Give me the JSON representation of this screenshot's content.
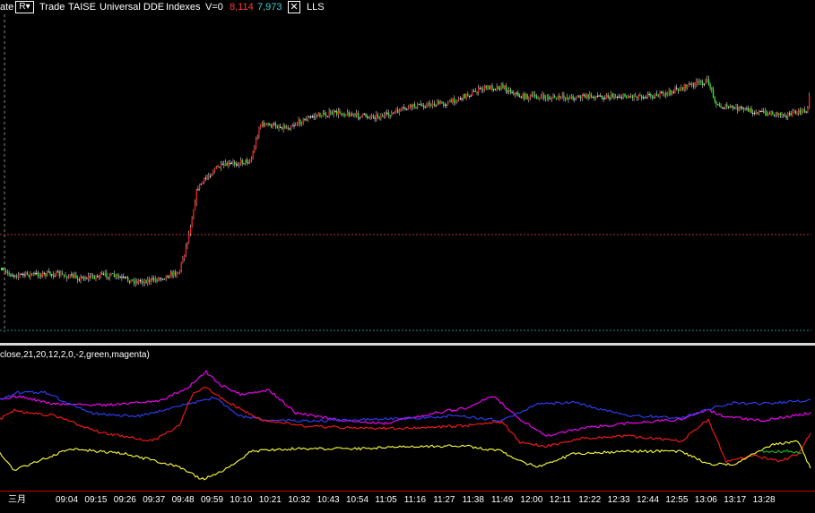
{
  "header": {
    "left_fragment": "ate",
    "mode_button": "R▾",
    "trade_label": "Trade",
    "symbol": "TAISE",
    "source": "Universal DDE",
    "category": "Indexes",
    "volume": "V=0",
    "up_count": "8,114",
    "down_count": "7,973",
    "close_glyph": "✕",
    "tool": "LLS",
    "up_color": "#ff3b3b",
    "down_color": "#3fd0d0"
  },
  "indicator": {
    "label": "close,21,20,12,2,0,-2,green,magenta)"
  },
  "axis": {
    "month": "三月",
    "times": [
      "09:04",
      "09:15",
      "09:26",
      "09:37",
      "09:48",
      "09:59",
      "10:10",
      "10:21",
      "10:32",
      "10:43",
      "10:54",
      "11:05",
      "11:16",
      "11:27",
      "11:38",
      "11:49",
      "12:00",
      "12:11",
      "12:22",
      "12:33",
      "12:44",
      "12:55",
      "13:06",
      "13:17",
      "13:28"
    ]
  },
  "chart_data": [
    {
      "type": "candlestick",
      "colors": {
        "up": "#ff2020",
        "down": "#20ff20",
        "neutral": "#ffffff"
      },
      "reference_line": "dotted red horizontal",
      "price_path": [
        [
          0,
          0.79
        ],
        [
          20,
          0.795
        ],
        [
          60,
          0.792
        ],
        [
          90,
          0.805
        ],
        [
          120,
          0.795
        ],
        [
          150,
          0.815
        ],
        [
          170,
          0.812
        ],
        [
          200,
          0.785
        ],
        [
          210,
          0.68
        ],
        [
          220,
          0.53
        ],
        [
          240,
          0.47
        ],
        [
          260,
          0.455
        ],
        [
          280,
          0.445
        ],
        [
          290,
          0.335
        ],
        [
          320,
          0.345
        ],
        [
          350,
          0.31
        ],
        [
          380,
          0.3
        ],
        [
          400,
          0.31
        ],
        [
          430,
          0.31
        ],
        [
          460,
          0.28
        ],
        [
          500,
          0.27
        ],
        [
          540,
          0.225
        ],
        [
          560,
          0.22
        ],
        [
          580,
          0.25
        ],
        [
          620,
          0.255
        ],
        [
          660,
          0.25
        ],
        [
          700,
          0.25
        ],
        [
          740,
          0.245
        ],
        [
          770,
          0.215
        ],
        [
          790,
          0.205
        ],
        [
          800,
          0.28
        ],
        [
          830,
          0.29
        ],
        [
          850,
          0.3
        ],
        [
          880,
          0.305
        ],
        [
          900,
          0.295
        ],
        [
          905,
          0.21
        ]
      ]
    },
    {
      "type": "line",
      "series": [
        {
          "color": "#ff00ff",
          "values": [
            [
              0,
              0.3
            ],
            [
              20,
              0.27
            ],
            [
              60,
              0.33
            ],
            [
              120,
              0.34
            ],
            [
              180,
              0.3
            ],
            [
              210,
              0.2
            ],
            [
              230,
              0.08
            ],
            [
              245,
              0.18
            ],
            [
              270,
              0.26
            ],
            [
              300,
              0.22
            ],
            [
              330,
              0.4
            ],
            [
              380,
              0.46
            ],
            [
              430,
              0.48
            ],
            [
              470,
              0.42
            ],
            [
              520,
              0.36
            ],
            [
              550,
              0.27
            ],
            [
              580,
              0.45
            ],
            [
              610,
              0.58
            ],
            [
              650,
              0.52
            ],
            [
              700,
              0.48
            ],
            [
              760,
              0.45
            ],
            [
              790,
              0.38
            ],
            [
              810,
              0.43
            ],
            [
              850,
              0.46
            ],
            [
              905,
              0.4
            ]
          ]
        },
        {
          "color": "#3040ff",
          "values": [
            [
              0,
              0.3
            ],
            [
              20,
              0.24
            ],
            [
              50,
              0.24
            ],
            [
              100,
              0.4
            ],
            [
              150,
              0.43
            ],
            [
              210,
              0.33
            ],
            [
              240,
              0.28
            ],
            [
              265,
              0.42
            ],
            [
              300,
              0.46
            ],
            [
              360,
              0.46
            ],
            [
              420,
              0.45
            ],
            [
              470,
              0.44
            ],
            [
              510,
              0.42
            ],
            [
              560,
              0.46
            ],
            [
              600,
              0.33
            ],
            [
              640,
              0.32
            ],
            [
              700,
              0.42
            ],
            [
              760,
              0.44
            ],
            [
              790,
              0.37
            ],
            [
              820,
              0.32
            ],
            [
              850,
              0.33
            ],
            [
              905,
              0.3
            ]
          ]
        },
        {
          "color": "#ff1a1a",
          "values": [
            [
              0,
              0.45
            ],
            [
              15,
              0.38
            ],
            [
              30,
              0.4
            ],
            [
              60,
              0.42
            ],
            [
              110,
              0.55
            ],
            [
              170,
              0.62
            ],
            [
              200,
              0.5
            ],
            [
              215,
              0.25
            ],
            [
              230,
              0.2
            ],
            [
              255,
              0.32
            ],
            [
              290,
              0.45
            ],
            [
              340,
              0.5
            ],
            [
              400,
              0.52
            ],
            [
              450,
              0.52
            ],
            [
              520,
              0.5
            ],
            [
              560,
              0.47
            ],
            [
              580,
              0.63
            ],
            [
              610,
              0.66
            ],
            [
              650,
              0.6
            ],
            [
              700,
              0.58
            ],
            [
              760,
              0.62
            ],
            [
              790,
              0.45
            ],
            [
              810,
              0.78
            ],
            [
              840,
              0.73
            ],
            [
              870,
              0.78
            ],
            [
              890,
              0.72
            ],
            [
              905,
              0.55
            ]
          ]
        },
        {
          "color": "#ffff40",
          "values": [
            [
              0,
              0.72
            ],
            [
              15,
              0.85
            ],
            [
              40,
              0.78
            ],
            [
              80,
              0.68
            ],
            [
              140,
              0.72
            ],
            [
              200,
              0.82
            ],
            [
              225,
              0.92
            ],
            [
              250,
              0.85
            ],
            [
              280,
              0.7
            ],
            [
              330,
              0.68
            ],
            [
              400,
              0.68
            ],
            [
              460,
              0.66
            ],
            [
              520,
              0.66
            ],
            [
              560,
              0.7
            ],
            [
              580,
              0.78
            ],
            [
              600,
              0.82
            ],
            [
              640,
              0.72
            ],
            [
              700,
              0.7
            ],
            [
              760,
              0.7
            ],
            [
              790,
              0.8
            ],
            [
              820,
              0.8
            ],
            [
              860,
              0.65
            ],
            [
              890,
              0.62
            ],
            [
              905,
              0.85
            ]
          ]
        },
        {
          "color": "#20c020",
          "values": [
            [
              850,
              0.7
            ],
            [
              880,
              0.7
            ],
            [
              895,
              0.72
            ]
          ]
        }
      ]
    }
  ]
}
